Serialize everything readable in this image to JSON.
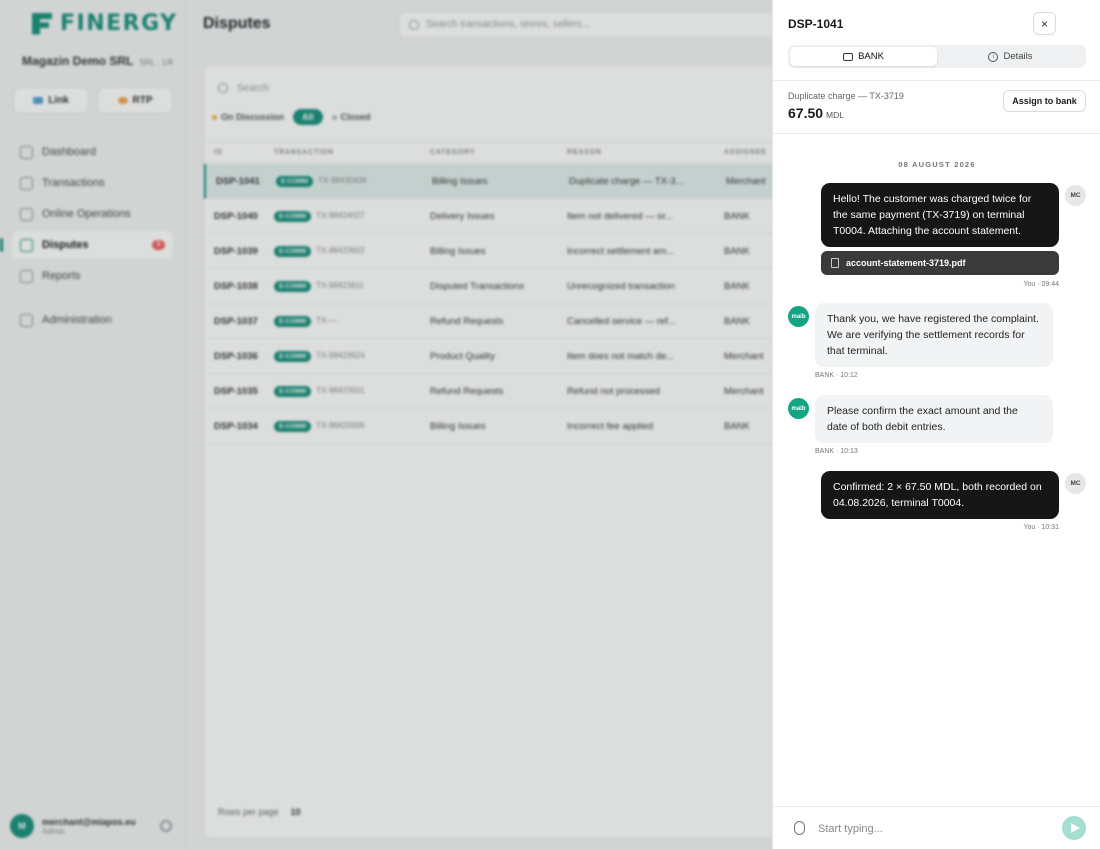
{
  "app": {
    "brand": "FINERGY",
    "merchant_name": "Magazin Demo SRL",
    "merchant_meta": "SRL · 1/8",
    "buttons": [
      {
        "label": "Link"
      },
      {
        "label": "RTP"
      }
    ],
    "nav": [
      {
        "label": "Dashboard"
      },
      {
        "label": "Transactions"
      },
      {
        "label": "Online Operations"
      },
      {
        "label": "Disputes",
        "badge": "3"
      },
      {
        "label": "Reports"
      },
      {
        "label": "Administration"
      }
    ],
    "user": {
      "initial": "M",
      "email": "merchant@miapos.eu",
      "role": "Admin"
    },
    "page_title": "Disputes",
    "top_search_placeholder": "Search transactions, stores, sellers...",
    "table_search_placeholder": "Search",
    "filters": {
      "on_discussion": "On Discussion",
      "all": "All",
      "closed": "Closed"
    },
    "columns": [
      "ID",
      "TRANSACTION",
      "CATEGORY",
      "REASON",
      "ASSIGNEE"
    ],
    "rows": [
      {
        "id": "DSP-1041",
        "channel": "E-COMM",
        "tx": "TX-98430436",
        "category": "Billing Issues",
        "reason": "Duplicate charge — TX-3...",
        "assignee": "Merchant"
      },
      {
        "id": "DSP-1040",
        "channel": "E-COMM",
        "tx": "TX-98424027",
        "category": "Delivery Issues",
        "reason": "Item not delivered — or...",
        "assignee": "BANK"
      },
      {
        "id": "DSP-1039",
        "channel": "E-COMM",
        "tx": "TX-98423602",
        "category": "Billing Issues",
        "reason": "Incorrect settlement am...",
        "assignee": "BANK"
      },
      {
        "id": "DSP-1038",
        "channel": "E-COMM",
        "tx": "TX-98423611",
        "category": "Disputed Transactions",
        "reason": "Unrecognized transaction",
        "assignee": "BANK"
      },
      {
        "id": "DSP-1037",
        "channel": "E-COMM",
        "tx": "TX-—",
        "category": "Refund Requests",
        "reason": "Cancelled service — ref...",
        "assignee": "BANK"
      },
      {
        "id": "DSP-1036",
        "channel": "E-COMM",
        "tx": "TX-98423624",
        "category": "Product Quality",
        "reason": "Item does not match de...",
        "assignee": "Merchant"
      },
      {
        "id": "DSP-1035",
        "channel": "E-COMM",
        "tx": "TX-98423501",
        "category": "Refund Requests",
        "reason": "Refund not processed",
        "assignee": "Merchant"
      },
      {
        "id": "DSP-1034",
        "channel": "E-COMM",
        "tx": "TX-98420006",
        "category": "Billing Issues",
        "reason": "Incorrect fee applied",
        "assignee": "BANK"
      }
    ],
    "rows_per_page_label": "Rows per page",
    "rows_per_page_value": "10"
  },
  "panel": {
    "title": "DSP-1041",
    "close_glyph": "×",
    "tabs": [
      {
        "label": "BANK",
        "icon": "chat-icon",
        "active": true
      },
      {
        "label": "Details",
        "icon": "info-icon",
        "active": false
      }
    ],
    "subtitle": "Duplicate charge — TX-3719",
    "amount": "67.50",
    "currency": "MDL",
    "assign_label": "Assign to bank",
    "date_separator": "08 AUGUST 2026",
    "messages": [
      {
        "from": "merchant",
        "avatar": "MC",
        "text": "Hello! The customer was charged twice for the same payment (TX-3719) on terminal T0004. Attaching the account statement.",
        "attachment": "account-statement-3719.pdf",
        "meta": "You · 09:44"
      },
      {
        "from": "bank",
        "avatar": "maib",
        "text": "Thank you, we have registered the complaint. We are verifying the settlement records for that terminal.",
        "meta": "BANK · 10:12"
      },
      {
        "from": "bank",
        "avatar": "maib",
        "text": "Please confirm the exact amount and the date of both debit entries.",
        "meta": "BANK · 10:13"
      },
      {
        "from": "merchant",
        "avatar": "MC",
        "text": "Confirmed: 2 × 67.50 MDL, both recorded on 04.08.2026, terminal T0004.",
        "meta": "You · 10:31"
      }
    ],
    "input_placeholder": "Start typing...",
    "colors": {
      "accent": "#138f7a",
      "bank_avatar": "#14a585",
      "outgoing_bubble": "#161616",
      "send_button": "#a6ddd1"
    }
  }
}
